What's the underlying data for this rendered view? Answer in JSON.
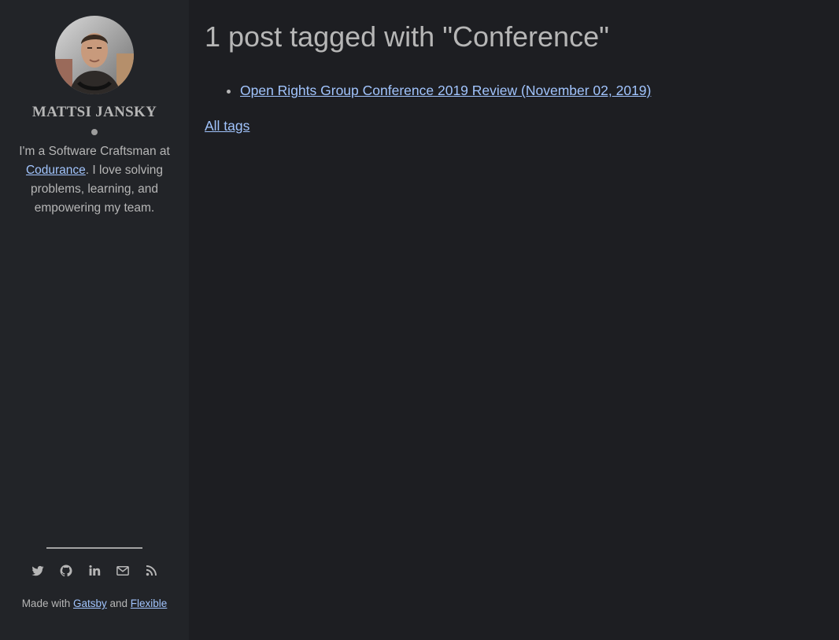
{
  "sidebar": {
    "author_name": "Mattsi Jansky",
    "bio_before": "I'm a Software Craftsman at ",
    "bio_link": "Codurance",
    "bio_after": ". I love solving problems, learning, and empowering my team.",
    "social_icons": [
      "twitter-icon",
      "github-icon",
      "linkedin-icon",
      "email-icon",
      "rss-icon"
    ],
    "made_with_prefix": "Made with ",
    "made_with_link1": "Gatsby",
    "made_with_mid": " and ",
    "made_with_link2": "Flexible"
  },
  "main": {
    "title": "1 post tagged with \"Conference\"",
    "posts": [
      {
        "label": "Open Rights Group Conference 2019 Review (November 02, 2019)"
      }
    ],
    "all_tags_label": "All tags"
  },
  "colors": {
    "background": "#1d1e22",
    "sidebar": "#222428",
    "text": "#b6b6b6",
    "link": "#a1c4fd"
  }
}
